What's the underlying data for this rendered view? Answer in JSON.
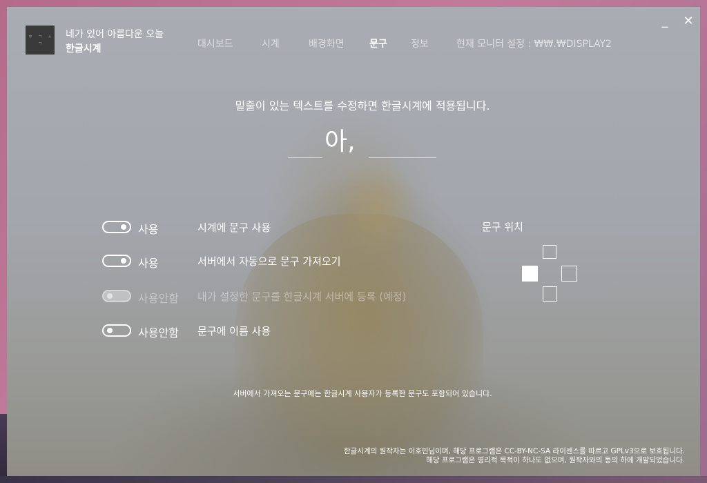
{
  "app": {
    "subtitle": "네가 있어 아름다운 오늘",
    "title": "한글시계",
    "logo_chars": [
      "ㅎ",
      "ㄱ",
      "ㅅ",
      "ㄱ"
    ]
  },
  "window_controls": {
    "minimize": "_",
    "close": "✕"
  },
  "nav": {
    "items": [
      "대시보드",
      "시계",
      "배경화면",
      "문구",
      "정보"
    ],
    "active": "문구",
    "monitor_setting": "현재 모니터 설정 : ₩₩.₩DISPLAY2"
  },
  "main": {
    "instruction": "밑줄이 있는 텍스트를 수정하면 한글시계에 적용됩니다.",
    "phrase": "아,",
    "toggles": [
      {
        "state": "사용",
        "desc": "시계에 문구 사용",
        "on": true,
        "disabled": false
      },
      {
        "state": "사용",
        "desc": "서버에서 자동으로 문구 가져오기",
        "on": true,
        "disabled": false
      },
      {
        "state": "사용안함",
        "desc": "내가 설정한 문구를 한글시계 서버에 등록 (예정)",
        "on": false,
        "disabled": true
      },
      {
        "state": "사용안함",
        "desc": "문구에 이름 사용",
        "on": false,
        "disabled": false
      }
    ],
    "position_label": "문구 위치",
    "position_selected": "left",
    "server_notice": "서버에서 가져오는 문구에는 한글시계 사용자가 등록한 문구도 포함되어 있습니다."
  },
  "footer": {
    "line1": "한글시계의 원작자는 이호민님이며, 해당 프로그램은 CC-BY-NC-SA 라이센스를 따르고 GPLv3으로 보호됩니다.",
    "line2": "해당 프로그램은 영리적 목적이 하나도 없으며, 원작자와의 동의 하에 개발되었습니다."
  },
  "colors": {
    "text": "#ffffff",
    "logo_bg": "#3a3a3a",
    "frame": "#b56a8a"
  }
}
